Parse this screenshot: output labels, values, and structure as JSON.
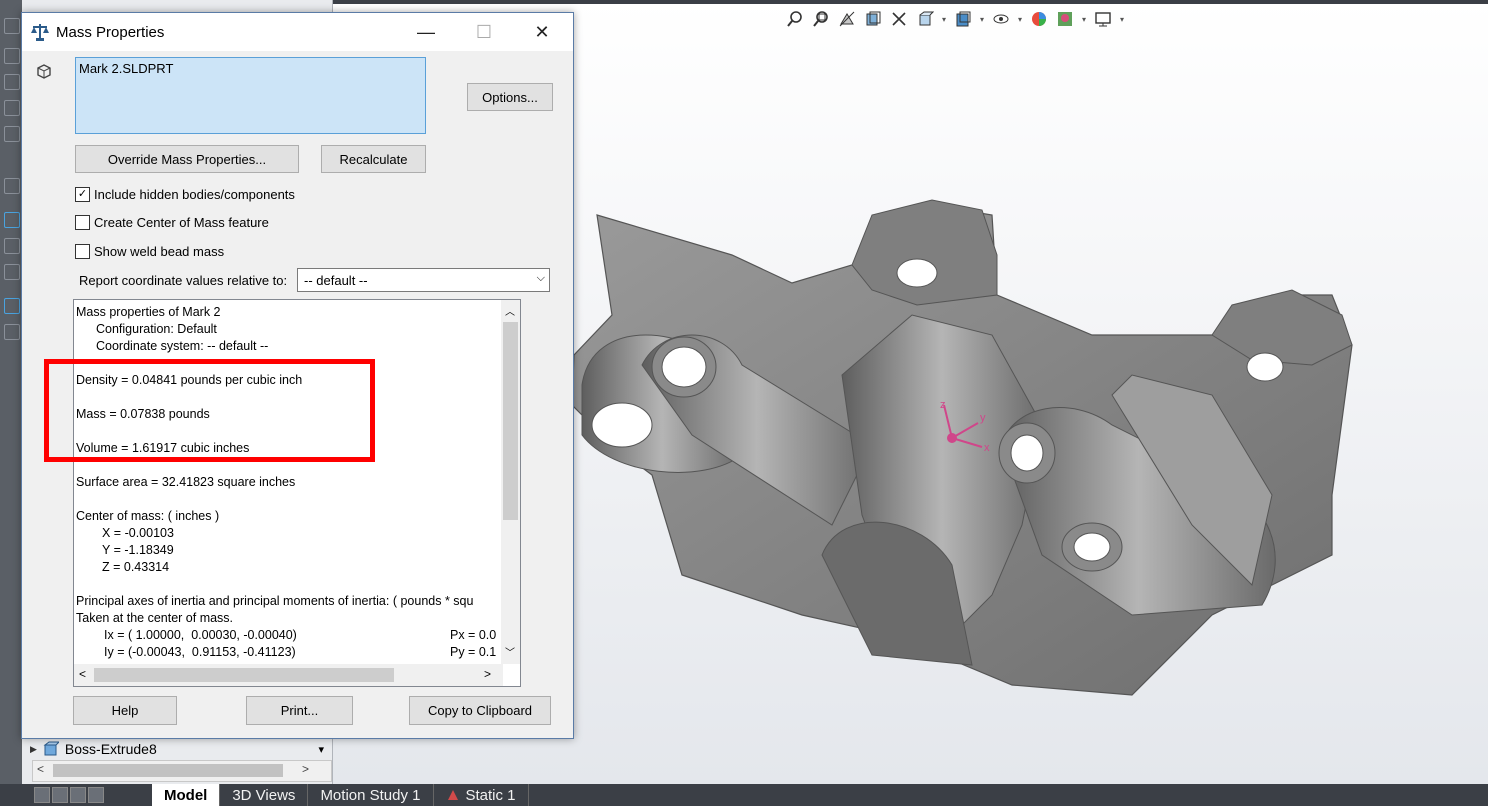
{
  "dialog": {
    "title": "Mass Properties",
    "selection": "Mark 2.SLDPRT",
    "options_button": "Options...",
    "override_button": "Override Mass Properties...",
    "recalculate_button": "Recalculate",
    "include_hidden_label": "Include hidden bodies/components",
    "include_hidden_checked": true,
    "create_com_label": "Create Center of Mass feature",
    "create_com_checked": false,
    "weld_bead_label": "Show weld bead mass",
    "weld_bead_checked": false,
    "report_label": "Report coordinate values relative to:",
    "coord_system_value": "-- default --",
    "help_button": "Help",
    "print_button": "Print...",
    "copy_button": "Copy to Clipboard"
  },
  "results": {
    "heading": "Mass properties of Mark 2",
    "configuration": "Configuration: Default",
    "coordinate_system": "Coordinate system: -- default --",
    "density": "Density = 0.04841 pounds per cubic inch",
    "mass": "Mass = 0.07838 pounds",
    "volume": "Volume = 1.61917 cubic inches",
    "surface_area": "Surface area = 32.41823 square inches",
    "com_heading": "Center of mass: ( inches )",
    "com_x": "X = -0.00103",
    "com_y": "Y = -1.18349",
    "com_z": "Z = 0.43314",
    "principal_heading": "Principal axes of inertia and principal moments of inertia: ( pounds * squ",
    "taken_at": "Taken at the center of mass.",
    "ix": "Ix = ( 1.00000,  0.00030, -0.00040)",
    "px": "Px = 0.0",
    "iy": "Iy = (-0.00043,  0.91153, -0.41123)",
    "py": "Py = 0.1"
  },
  "feature_manager": {
    "visible_item": "Boss-Extrude8"
  },
  "bottom_tabs": [
    "Model",
    "3D Views",
    "Motion Study 1",
    "Static 1"
  ],
  "triad_labels": {
    "x": "x",
    "y": "y",
    "z": "z"
  },
  "colors": {
    "highlight": "#ff0000",
    "selection_bg": "#cce4f7",
    "part_gray": "#8a8a8a",
    "triad": "#d0468a"
  }
}
